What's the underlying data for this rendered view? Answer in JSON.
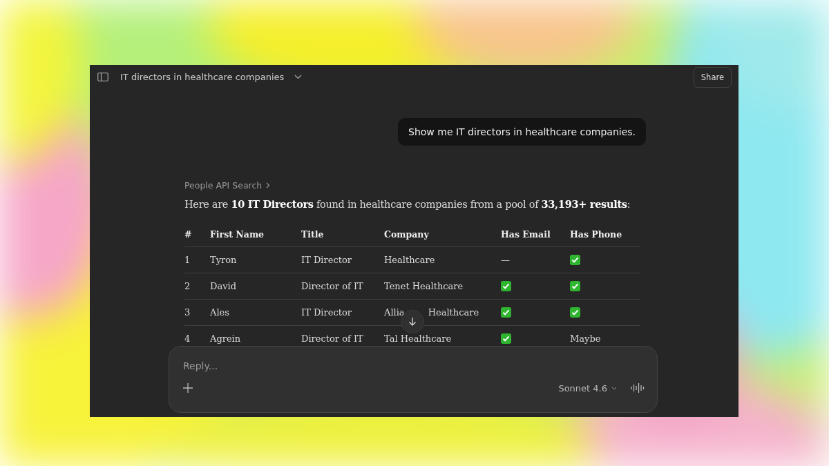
{
  "window": {
    "title": "IT directors in healthcare companies",
    "share": "Share"
  },
  "user_message": "Show me IT directors in healthcare companies.",
  "tool_call": "People API Search",
  "summary": "Here are **10 IT Directors** found in healthcare companies from a pool of **33,193+ results**:",
  "table": {
    "columns": [
      "#",
      "First Name",
      "Title",
      "Company",
      "Has Email",
      "Has Phone"
    ],
    "rows": [
      {
        "num": "1",
        "first_name": "Tyron",
        "title": "IT Director",
        "company": [
          "Healthcare"
        ],
        "email": {
          "kind": "dash",
          "text": "—"
        },
        "phone": {
          "kind": "check"
        }
      },
      {
        "num": "2",
        "first_name": "David",
        "title": "Director of IT",
        "company": [
          "Tenet Healthcare"
        ],
        "email": {
          "kind": "check"
        },
        "phone": {
          "kind": "check"
        }
      },
      {
        "num": "3",
        "first_name": "Ales",
        "title": "IT Director",
        "company": [
          "Allia",
          "Healthcare"
        ],
        "email": {
          "kind": "check"
        },
        "phone": {
          "kind": "check"
        }
      },
      {
        "num": "4",
        "first_name": "Agrein",
        "title": "Director of IT",
        "company": [
          "Tal Healthcare"
        ],
        "email": {
          "kind": "check"
        },
        "phone": {
          "kind": "text",
          "text": "Maybe"
        }
      }
    ]
  },
  "composer": {
    "placeholder": "Reply...",
    "model": "Sonnet 4.6"
  }
}
